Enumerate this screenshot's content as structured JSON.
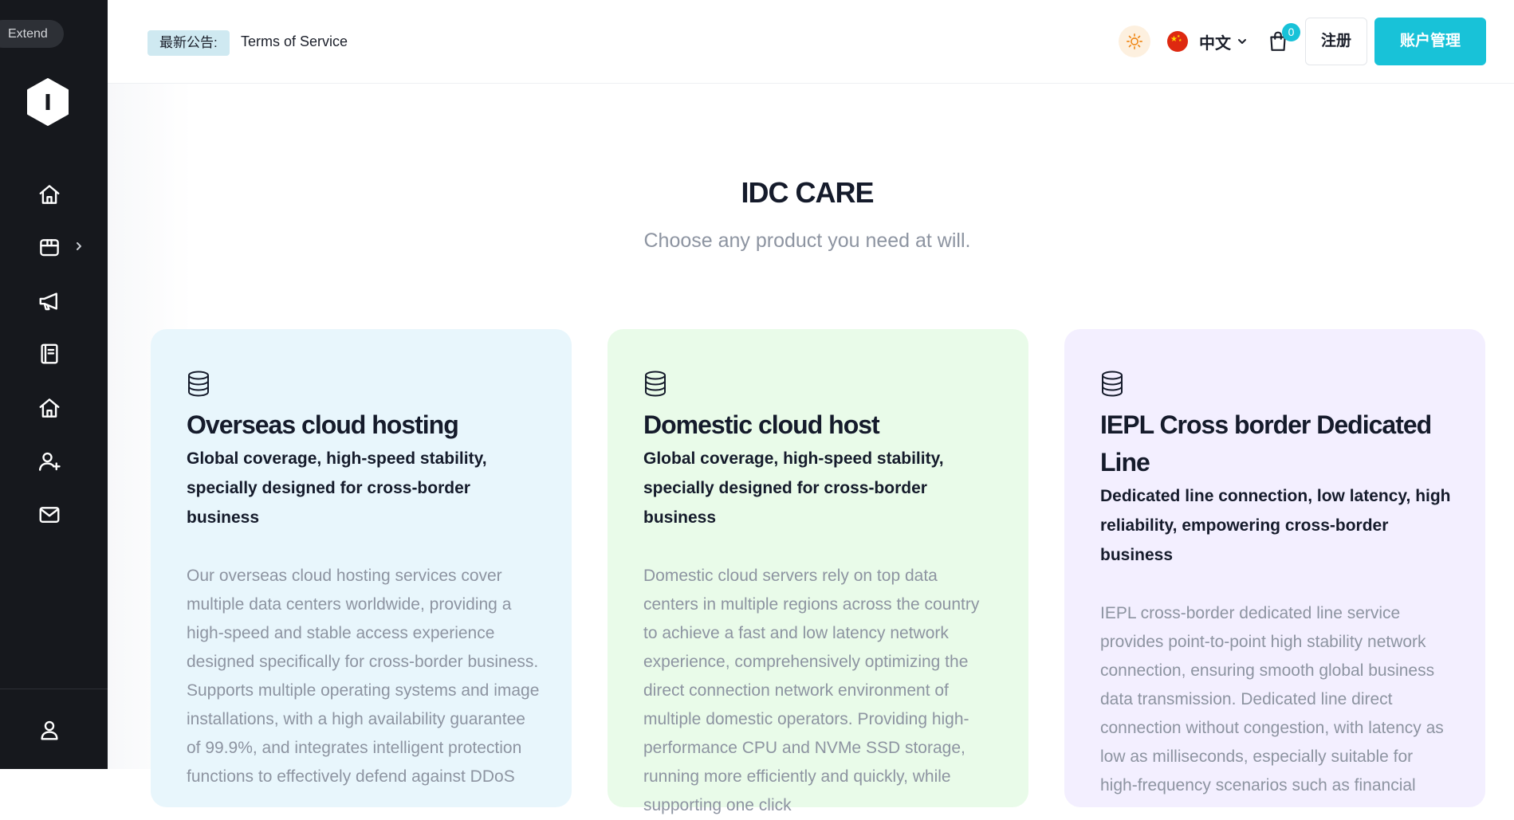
{
  "sidebar": {
    "extend_label": "Extend",
    "logo_letter": "I",
    "items": [
      {
        "name": "home"
      },
      {
        "name": "products"
      },
      {
        "name": "announcements"
      },
      {
        "name": "docs"
      },
      {
        "name": "home-2"
      },
      {
        "name": "add-user"
      },
      {
        "name": "messages"
      }
    ],
    "bottom_item": {
      "name": "user-profile"
    }
  },
  "header": {
    "notice_label": "最新公告:",
    "notice_text": "Terms of Service",
    "language": "中文",
    "cart_count": "0",
    "register_label": "注册",
    "account_label": "账户管理",
    "accent_color": "#18c2d8"
  },
  "hero": {
    "title": "IDC CARE",
    "subtitle": "Choose any product you need at will."
  },
  "cards": [
    {
      "title": "Overseas cloud hosting",
      "subtitle": "Global coverage, high-speed stability, specially designed for cross-border business",
      "body": "Our overseas cloud hosting services cover multiple data centers worldwide, providing a high-speed and stable access experience designed specifically for cross-border business. Supports multiple operating systems and image installations, with a high availability guarantee of 99.9%, and integrates intelligent protection functions to effectively defend against DDoS",
      "bg_color": "#e8f6fc"
    },
    {
      "title": "Domestic cloud host",
      "subtitle": "Global coverage, high-speed stability, specially designed for cross-border business",
      "body": "Domestic cloud servers rely on top data centers in multiple regions across the country to achieve a fast and low latency network experience, comprehensively optimizing the direct connection network environment of multiple domestic operators. Providing high-performance CPU and NVMe SSD storage, running more efficiently and quickly, while supporting one click",
      "bg_color": "#e9fbe9"
    },
    {
      "title": "IEPL Cross border Dedicated Line",
      "subtitle": "Dedicated line connection, low latency, high reliability, empowering cross-border business",
      "body": "IEPL cross-border dedicated line service provides point-to-point high stability network connection, ensuring smooth global business data transmission. Dedicated line direct connection without congestion, with latency as low as milliseconds, especially suitable for high-frequency scenarios such as financial",
      "bg_color": "#f3efff"
    }
  ]
}
